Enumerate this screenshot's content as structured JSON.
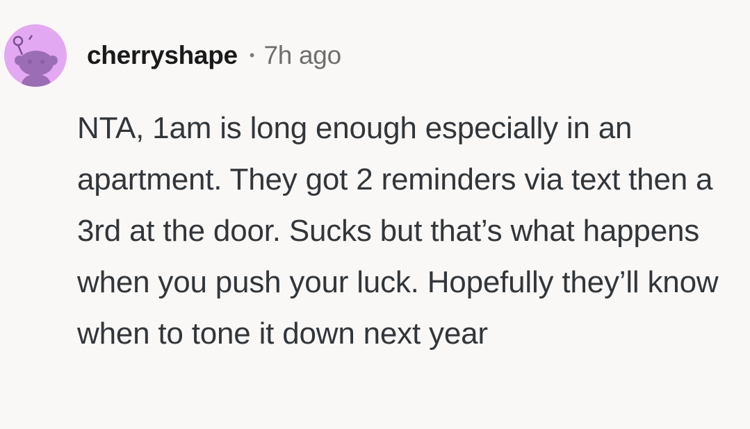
{
  "comment": {
    "author": "cherryshape",
    "separator": "•",
    "timestamp": "7h ago",
    "text": "NTA, 1am is long enough especially in an apartment. They got 2 reminders via text then a 3rd at the door. Sucks but that’s what happens when you push your luck. Hopefully they’ll know when to tone it down next year",
    "avatar_icon": "snoo-avatar-icon"
  },
  "colors": {
    "background": "#f9f8f6",
    "avatar_bg": "#e3a8f2",
    "avatar_figure": "#9a6db5",
    "username": "#1a1a1b",
    "timestamp": "#6e6e6e",
    "body_text": "#32363a"
  }
}
